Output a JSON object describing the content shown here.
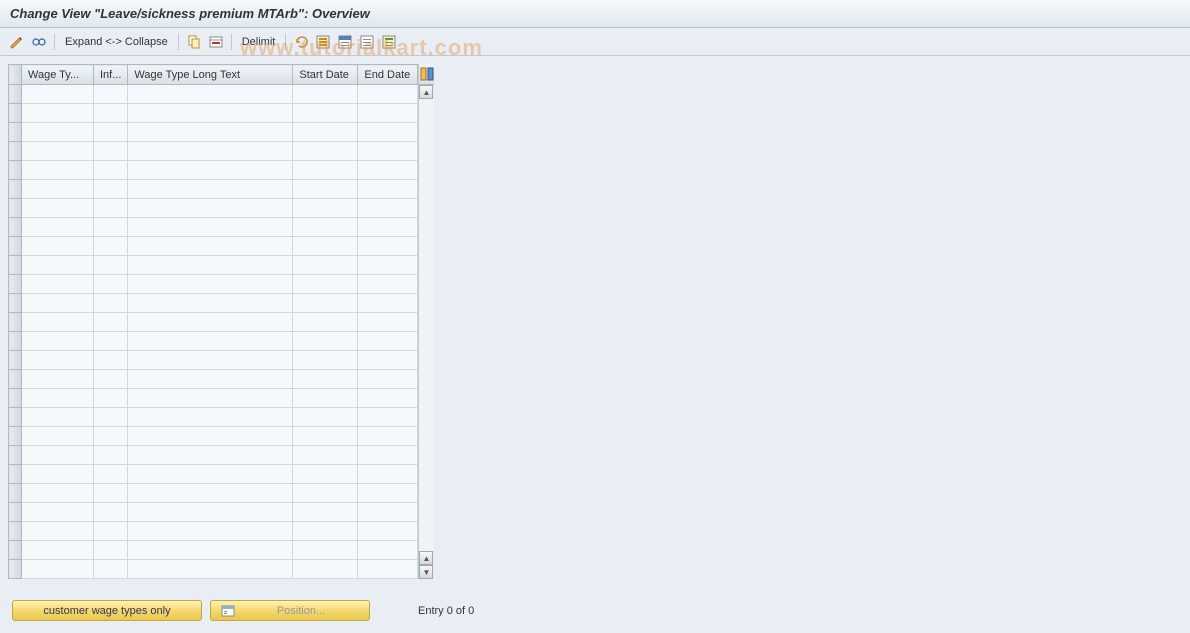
{
  "header": {
    "title": "Change View \"Leave/sickness premium MTArb\": Overview"
  },
  "toolbar": {
    "expand_collapse": "Expand <-> Collapse",
    "delimit": "Delimit"
  },
  "table": {
    "columns": {
      "wage_type": "Wage Ty...",
      "inf": "Inf...",
      "long_text": "Wage Type Long Text",
      "start_date": "Start Date",
      "end_date": "End Date"
    },
    "row_count": 26
  },
  "footer": {
    "customer_btn": "customer wage types only",
    "position_btn": "Position...",
    "status": "Entry 0 of 0"
  },
  "watermark": "www.tutorialkart.com"
}
